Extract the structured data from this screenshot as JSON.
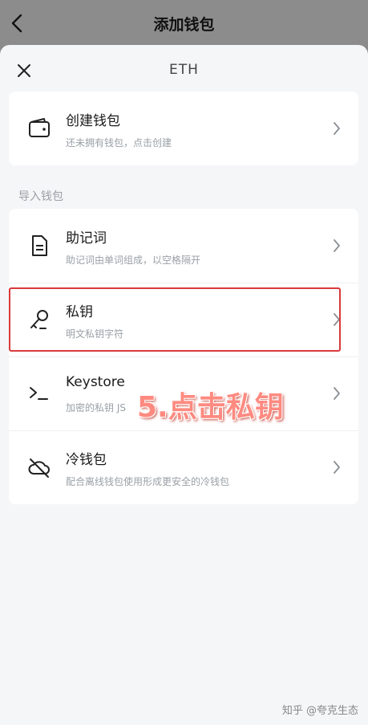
{
  "topbar": {
    "title": "添加钱包",
    "back_icon": "chevron-left-icon"
  },
  "sheet": {
    "title": "ETH",
    "close_icon": "close-icon"
  },
  "create_card": {
    "title": "创建钱包",
    "subtitle": "还未拥有钱包，点击创建",
    "icon": "wallet-icon"
  },
  "import_section": {
    "label": "导入钱包",
    "items": [
      {
        "title": "助记词",
        "subtitle": "助记词由单词组成，以空格隔开",
        "icon": "document-icon"
      },
      {
        "title": "私钥",
        "subtitle": "明文私钥字符",
        "icon": "key-icon"
      },
      {
        "title": "Keystore",
        "subtitle": "加密的私钥 JS",
        "icon": "terminal-icon"
      },
      {
        "title": "冷钱包",
        "subtitle": "配合离线钱包使用形成更安全的冷钱包",
        "icon": "cloud-off-icon"
      }
    ]
  },
  "annotation": {
    "text": "5.点击私钥",
    "color": "#ff8a80",
    "highlight_color": "#d93a3a"
  },
  "watermark": {
    "text": "知乎 @夸克生态"
  }
}
